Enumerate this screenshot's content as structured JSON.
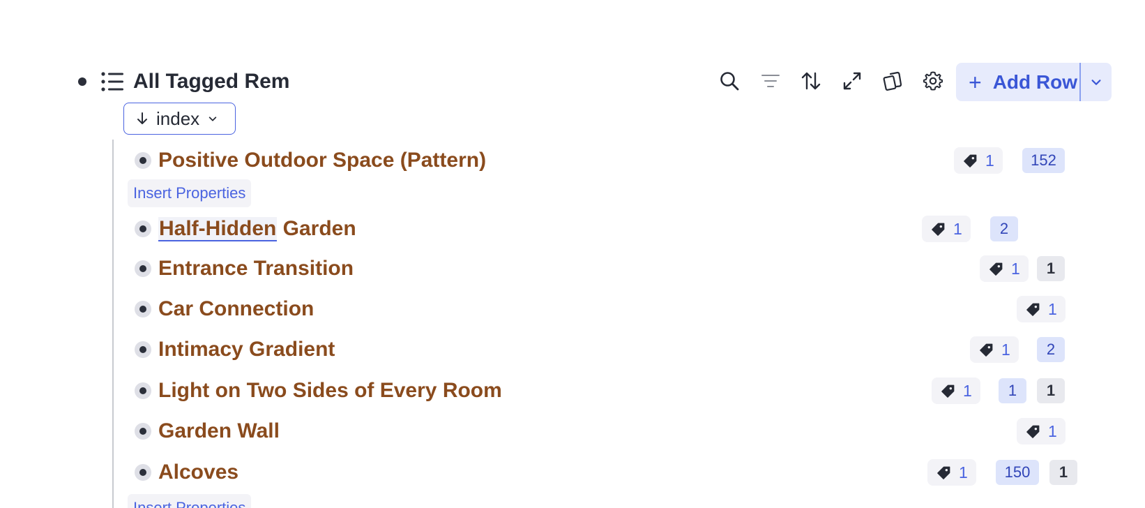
{
  "header": {
    "title": "All Tagged Rem",
    "toolbar": {
      "search_icon": "search-icon",
      "filter_icon": "filter-icon",
      "sort_icon": "sort-icon",
      "expand_icon": "expand-icon",
      "copy_icon": "copy-icon",
      "settings_icon": "gear-icon"
    },
    "add_row_label": "Add Row",
    "add_row_plus": "+"
  },
  "sort_chip": {
    "label": "index"
  },
  "rows": [
    {
      "text": "Positive Outdoor Space (Pattern)",
      "tag_count": "1",
      "count_blue": "152",
      "count_gray": ""
    },
    {
      "text_ref": "Half-Hidden",
      "text_rest": " Garden",
      "tag_count": "1",
      "count_blue": "2",
      "count_gray": ""
    },
    {
      "text": "Entrance Transition",
      "tag_count": "1",
      "count_blue": "",
      "count_gray": "1"
    },
    {
      "text": "Car Connection",
      "tag_count": "1",
      "count_blue": "",
      "count_gray": ""
    },
    {
      "text": "Intimacy Gradient",
      "tag_count": "1",
      "count_blue": "2",
      "count_gray": ""
    },
    {
      "text": "Light on Two Sides of Every Room",
      "tag_count": "1",
      "count_blue": "1",
      "count_gray": "1"
    },
    {
      "text": "Garden Wall",
      "tag_count": "1",
      "count_blue": "",
      "count_gray": ""
    },
    {
      "text": "Alcoves",
      "tag_count": "1",
      "count_blue": "150",
      "count_gray": "1"
    }
  ],
  "insert_properties_label": "Insert Properties",
  "colors": {
    "accent": "#4a63e0",
    "row_text": "#8a4b1d",
    "add_row_bg": "#e7ebfc"
  }
}
